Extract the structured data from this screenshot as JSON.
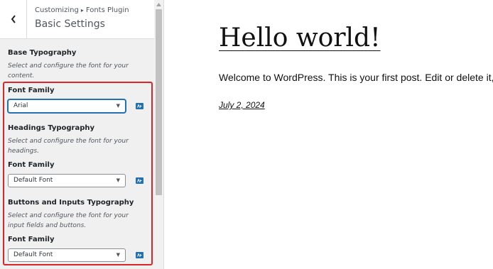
{
  "header": {
    "breadcrumb_prefix": "Customizing",
    "breadcrumb_separator": "▸",
    "breadcrumb_section": "Fonts Plugin",
    "section_title": "Basic Settings"
  },
  "groups": [
    {
      "heading": "Base Typography",
      "description": "Select and configure the font for your content.",
      "field_label": "Font Family",
      "selected": "Arial"
    },
    {
      "heading": "Headings Typography",
      "description": "Select and configure the font for your headings.",
      "field_label": "Font Family",
      "selected": "Default Font"
    },
    {
      "heading": "Buttons and Inputs Typography",
      "description": "Select and configure the font for your input fields and buttons.",
      "field_label": "Font Family",
      "selected": "Default Font"
    }
  ],
  "preview": {
    "title": "Hello world!",
    "body": "Welcome to WordPress. This is your first post. Edit or delete it, t",
    "date": "July 2, 2024"
  },
  "icons": {
    "back": "chevron-left-icon",
    "scroll_up": "triangle-up-icon",
    "font_action": "font-icon",
    "dropdown": "caret-down-icon"
  },
  "colors": {
    "accent": "#2271b1",
    "highlight": "#d9262b",
    "sidebar_bg": "#f0f0f1"
  }
}
